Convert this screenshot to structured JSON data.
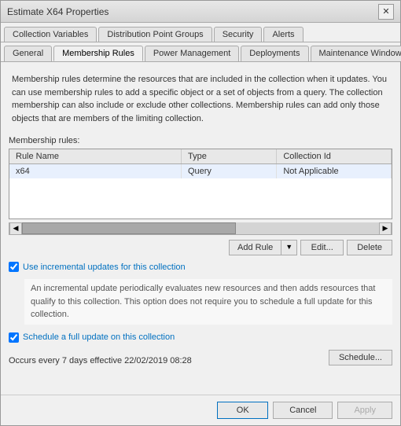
{
  "window": {
    "title": "Estimate X64 Properties",
    "close_label": "✕"
  },
  "tabs_row1": {
    "items": [
      {
        "label": "Collection Variables",
        "active": false
      },
      {
        "label": "Distribution Point Groups",
        "active": false
      },
      {
        "label": "Security",
        "active": false
      },
      {
        "label": "Alerts",
        "active": false
      }
    ]
  },
  "tabs_row2": {
    "items": [
      {
        "label": "General",
        "active": false
      },
      {
        "label": "Membership Rules",
        "active": true
      },
      {
        "label": "Power Management",
        "active": false
      },
      {
        "label": "Deployments",
        "active": false
      },
      {
        "label": "Maintenance Windows",
        "active": false
      }
    ]
  },
  "description": "Membership rules determine the resources that are included in the collection when it updates. You can use membership rules to add a specific object or a set of objects from a query. The collection membership can also include or exclude other collections. Membership rules can add only those objects that are members of the limiting collection.",
  "section_label": "Membership rules:",
  "table": {
    "columns": [
      "Rule Name",
      "Type",
      "Collection Id"
    ],
    "rows": [
      {
        "rule_name": "x64",
        "type": "Query",
        "collection_id": "Not Applicable"
      }
    ]
  },
  "buttons": {
    "add_rule": "Add Rule",
    "edit": "Edit...",
    "delete": "Delete"
  },
  "incremental_checkbox": {
    "checked": true,
    "label": "Use incremental updates for this collection"
  },
  "incremental_info": "An incremental update periodically evaluates new resources and then adds resources that qualify to this collection. This option does not require you to schedule a full update for this collection.",
  "schedule_checkbox": {
    "checked": true,
    "label": "Schedule a full update on this collection"
  },
  "occurs_text": "Occurs every 7 days effective 22/02/2019 08:28",
  "schedule_btn": "Schedule...",
  "footer": {
    "ok": "OK",
    "cancel": "Cancel",
    "apply": "Apply"
  }
}
